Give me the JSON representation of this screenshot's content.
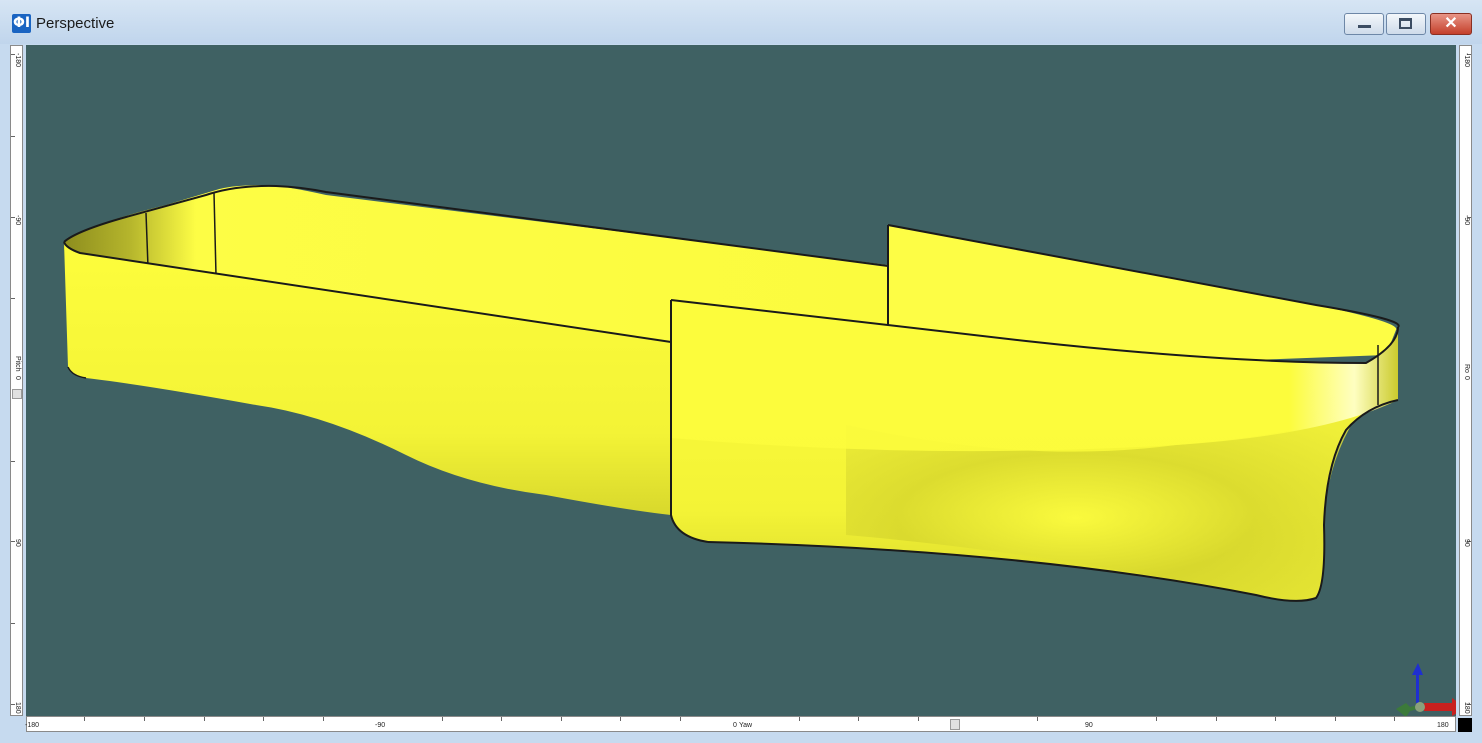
{
  "window": {
    "title": "Perspective",
    "app_icon_glyph": "ΦI",
    "controls": {
      "minimize_icon": "minimize-icon",
      "maximize_icon": "maximize-icon",
      "close_glyph": "✕"
    }
  },
  "viewport": {
    "background": "#3f6163",
    "model_color": "#fdfd3c",
    "model_outline": "#1a1a1a"
  },
  "rulers": {
    "pitch": {
      "label": "Pitch",
      "ticks": [
        "-180",
        "-90",
        "0",
        "90",
        "180"
      ]
    },
    "roll": {
      "label": "Ro",
      "ticks": [
        "-180",
        "-90",
        "0",
        "90",
        "180"
      ]
    },
    "yaw": {
      "label": "Yaw",
      "ticks": [
        "-180",
        "-90",
        "0",
        "90",
        "180"
      ]
    }
  },
  "axis_triad": {
    "z_color": "#1f2fd0",
    "x_color": "#c8201e",
    "y_color": "#3c7a3a"
  }
}
